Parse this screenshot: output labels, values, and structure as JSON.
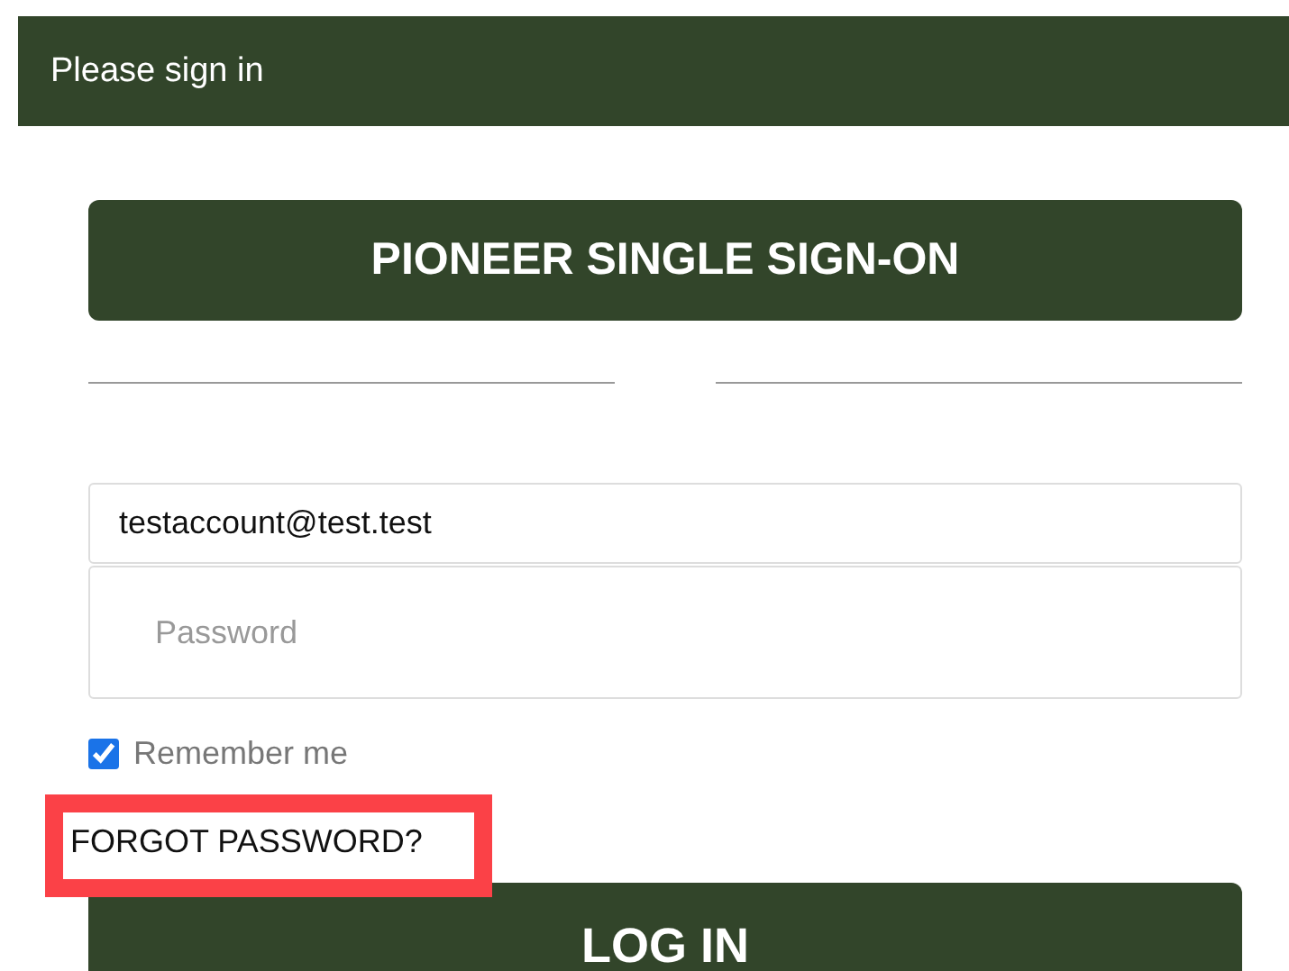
{
  "header": {
    "title": "Please sign in"
  },
  "sso_button": {
    "label": "PIONEER SINGLE SIGN-ON"
  },
  "email_field": {
    "value": "testaccount@test.test"
  },
  "password_field": {
    "placeholder": "Password"
  },
  "remember_me": {
    "label": "Remember me",
    "checked": true
  },
  "forgot_password": {
    "label": "FORGOT PASSWORD?",
    "highlighted": true
  },
  "login_button": {
    "label": "LOG IN"
  }
}
